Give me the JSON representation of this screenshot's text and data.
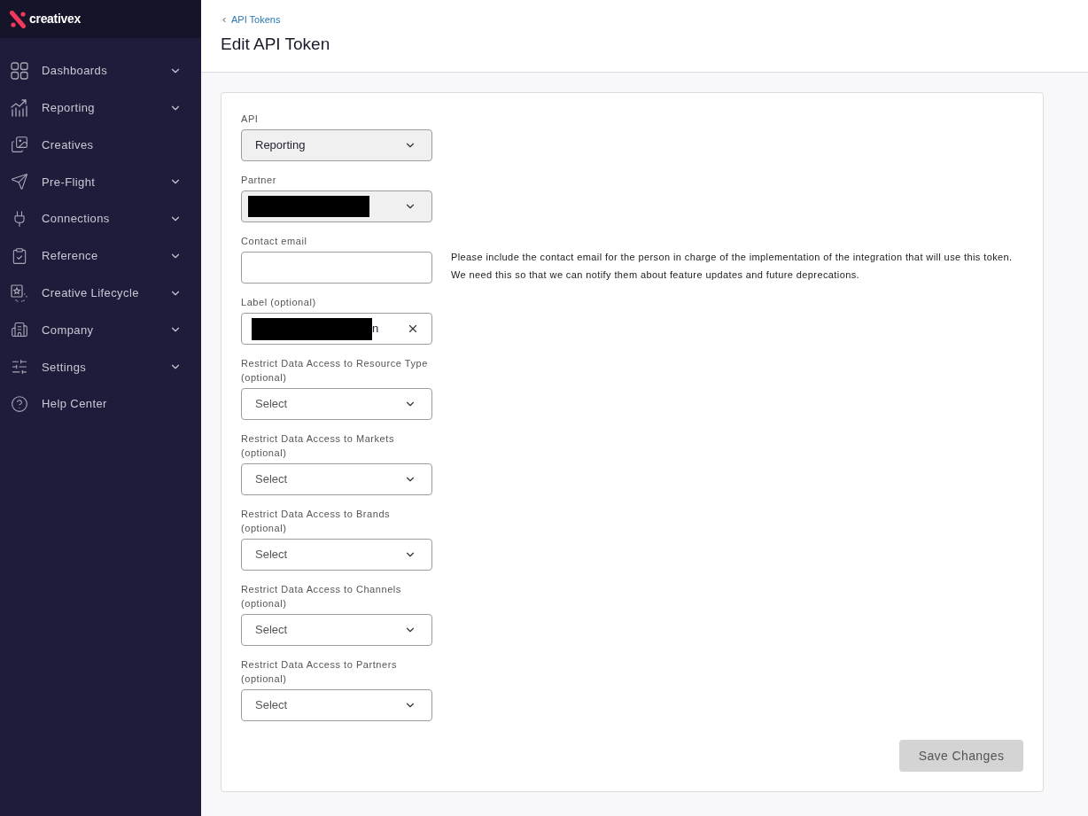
{
  "sidebar": {
    "logo": "creativex",
    "items": [
      {
        "label": "Dashboards",
        "expandable": true
      },
      {
        "label": "Reporting",
        "expandable": true
      },
      {
        "label": "Creatives",
        "expandable": false
      },
      {
        "label": "Pre-Flight",
        "expandable": true
      },
      {
        "label": "Connections",
        "expandable": true
      },
      {
        "label": "Reference",
        "expandable": true
      },
      {
        "label": "Creative Lifecycle",
        "expandable": true
      },
      {
        "label": "Company",
        "expandable": true
      },
      {
        "label": "Settings",
        "expandable": true
      },
      {
        "label": "Help Center",
        "expandable": false
      }
    ]
  },
  "header": {
    "back_link": "API Tokens",
    "title": "Edit API Token"
  },
  "form": {
    "fields": [
      {
        "kind": "select",
        "label": "API",
        "value": "Reporting",
        "disabled": true
      },
      {
        "kind": "select",
        "label": "Partner",
        "redacted": true,
        "disabled": true
      },
      {
        "kind": "text",
        "label": "Contact email",
        "help": [
          "Please include the contact email for the person in charge of the implementation of the integration that will use this token.",
          "We need this so that we can notify them about feature updates and future deprecations."
        ]
      },
      {
        "kind": "text",
        "label": "Label (optional)",
        "value": "n",
        "redacted": true,
        "clearable": true
      },
      {
        "kind": "select",
        "label": "Restrict Data Access to Resource Type (optional)",
        "placeholder": "Select",
        "disabled": false
      },
      {
        "kind": "select",
        "label": "Restrict Data Access to Markets (optional)",
        "placeholder": "Select",
        "disabled": false
      },
      {
        "kind": "select",
        "label": "Restrict Data Access to Brands (optional)",
        "placeholder": "Select",
        "disabled": false
      },
      {
        "kind": "select",
        "label": "Restrict Data Access to Channels (optional)",
        "placeholder": "Select",
        "disabled": false
      },
      {
        "kind": "select",
        "label": "Restrict Data Access to Partners (optional)",
        "placeholder": "Select",
        "disabled": false
      }
    ],
    "save_button": {
      "label": "Save Changes",
      "disabled": true
    }
  }
}
